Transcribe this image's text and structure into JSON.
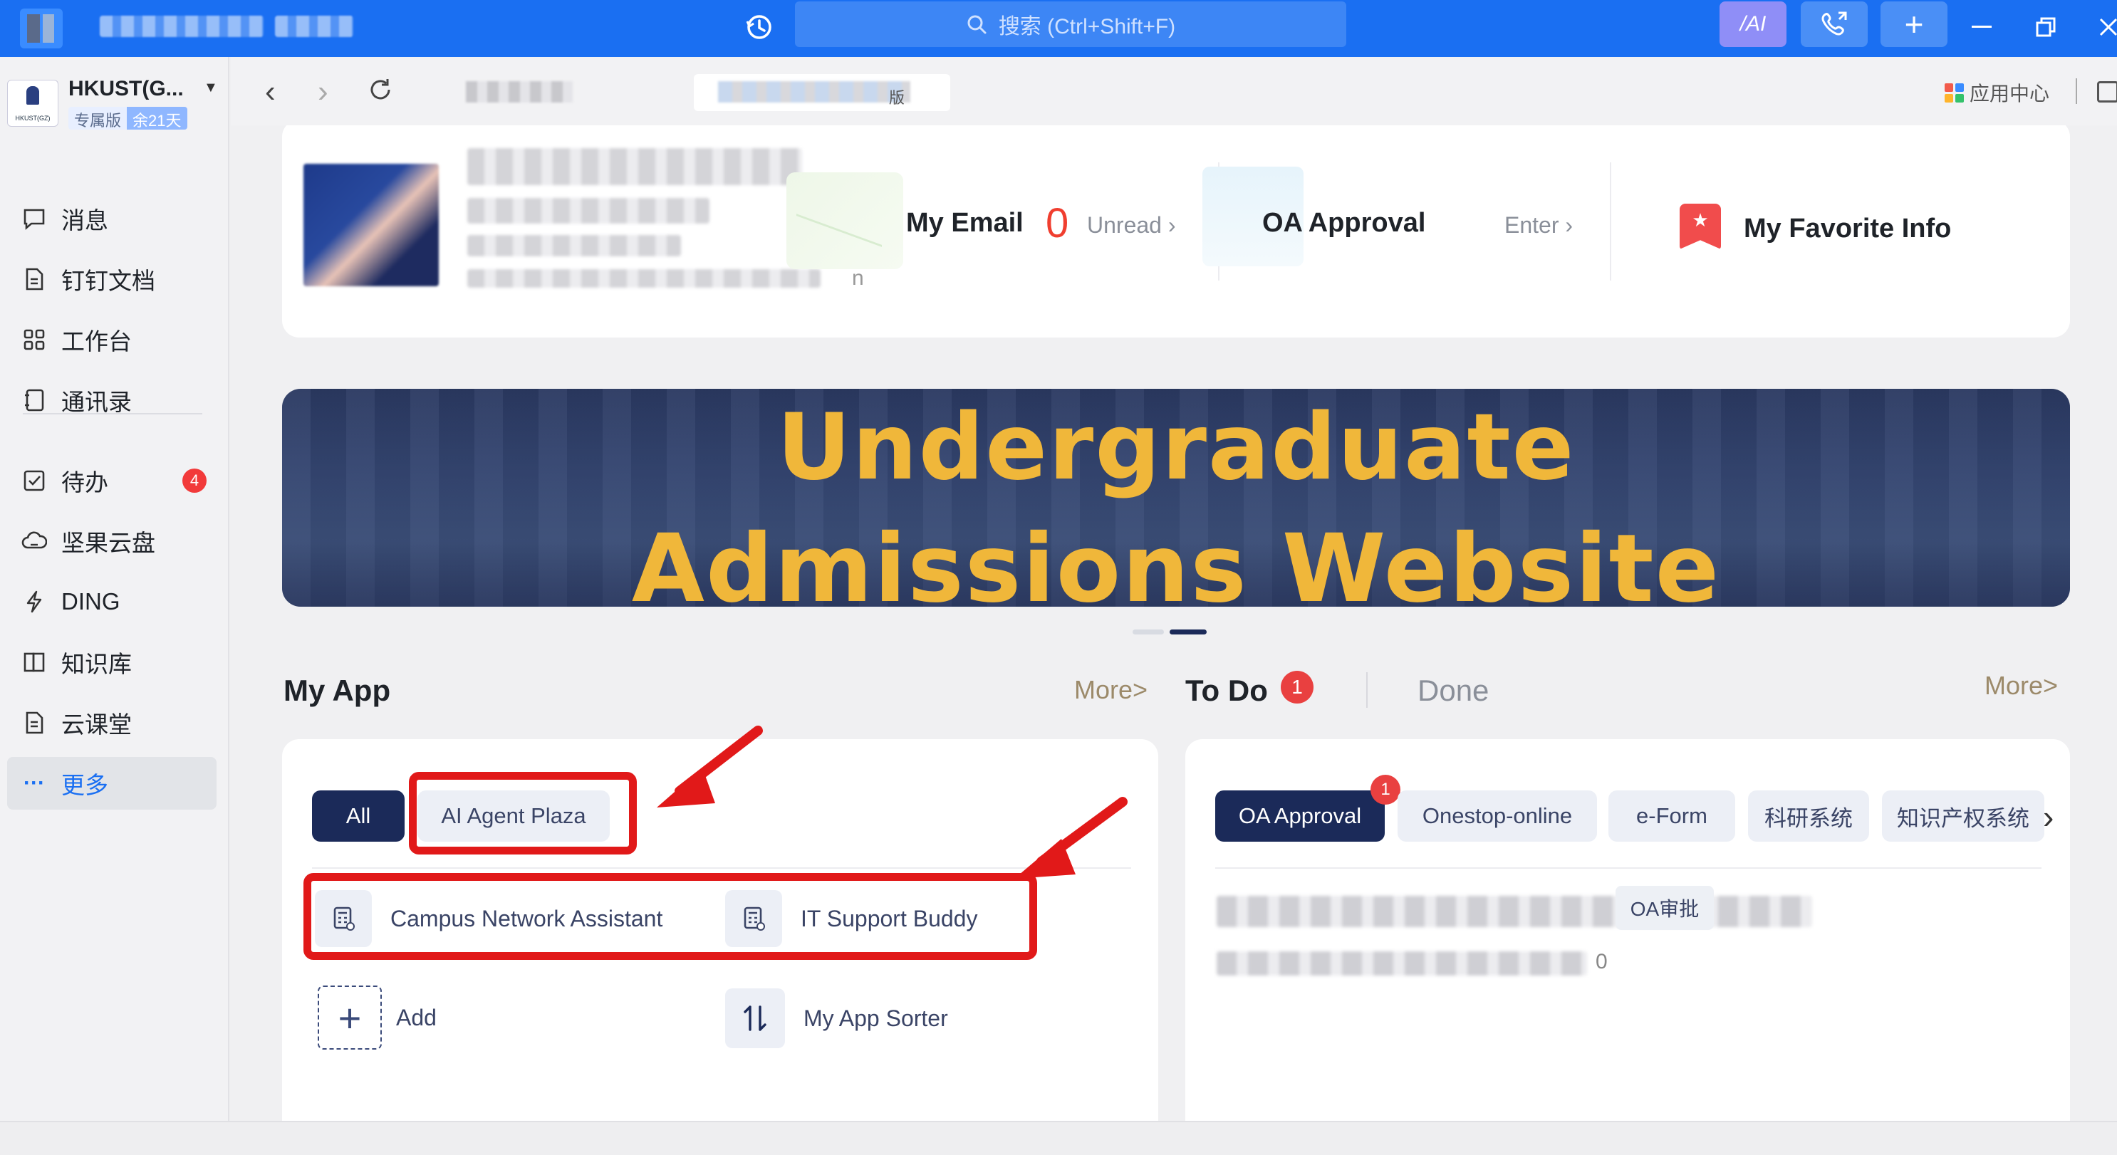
{
  "titlebar": {
    "search_placeholder": "搜索 (Ctrl+Shift+F)",
    "ai_label": "/AI"
  },
  "sidebar": {
    "org_name": "HKUST(G...",
    "org_badge_edition": "专属版",
    "org_badge_days": "余21天",
    "items": [
      {
        "label": "消息",
        "icon": "message-icon"
      },
      {
        "label": "钉钉文档",
        "icon": "document-icon"
      },
      {
        "label": "工作台",
        "icon": "workbench-grid-icon"
      },
      {
        "label": "通讯录",
        "icon": "contacts-icon"
      },
      {
        "label": "待办",
        "icon": "todo-check-icon",
        "badge": "4"
      },
      {
        "label": "坚果云盘",
        "icon": "cloud-drive-icon"
      },
      {
        "label": "DING",
        "icon": "ding-bolt-icon"
      },
      {
        "label": "知识库",
        "icon": "knowledge-book-icon"
      },
      {
        "label": "云课堂",
        "icon": "cloud-class-icon"
      },
      {
        "label": "更多",
        "icon": "more-dots-icon",
        "active": true
      }
    ]
  },
  "browser": {
    "tab_suffix": "版",
    "app_center": "应用中心"
  },
  "quick_links": {
    "email_title": "My Email",
    "email_count": "0",
    "email_sub": "Unread",
    "oa_title": "OA Approval",
    "oa_sub": "Enter",
    "fav_title": "My Favorite Info",
    "profile_trailing": "n"
  },
  "banner": {
    "line1": "Undergraduate",
    "line2": "Admissions Website"
  },
  "my_app": {
    "title": "My App",
    "more": "More>",
    "tabs": [
      {
        "label": "All",
        "selected": true
      },
      {
        "label": "AI Agent Plaza",
        "selected": false
      }
    ],
    "apps": [
      {
        "label": "Campus Network Assistant"
      },
      {
        "label": "IT Support Buddy"
      }
    ],
    "add_label": "Add",
    "sorter_label": "My App Sorter"
  },
  "todo": {
    "title": "To Do",
    "badge": "1",
    "done": "Done",
    "more": "More>",
    "filters": [
      {
        "label": "OA Approval",
        "selected": true,
        "badge": "1"
      },
      {
        "label": "Onestop-online"
      },
      {
        "label": "e-Form"
      },
      {
        "label": "科研系统"
      },
      {
        "label": "知识产权系统"
      }
    ],
    "item_tag": "OA审批",
    "item_trailing": "0"
  },
  "colors": {
    "titlebar": "#1a6ff2",
    "accent_red": "#e11919",
    "banner_text": "#f0b73a",
    "pill_dark": "#1b2a59"
  }
}
